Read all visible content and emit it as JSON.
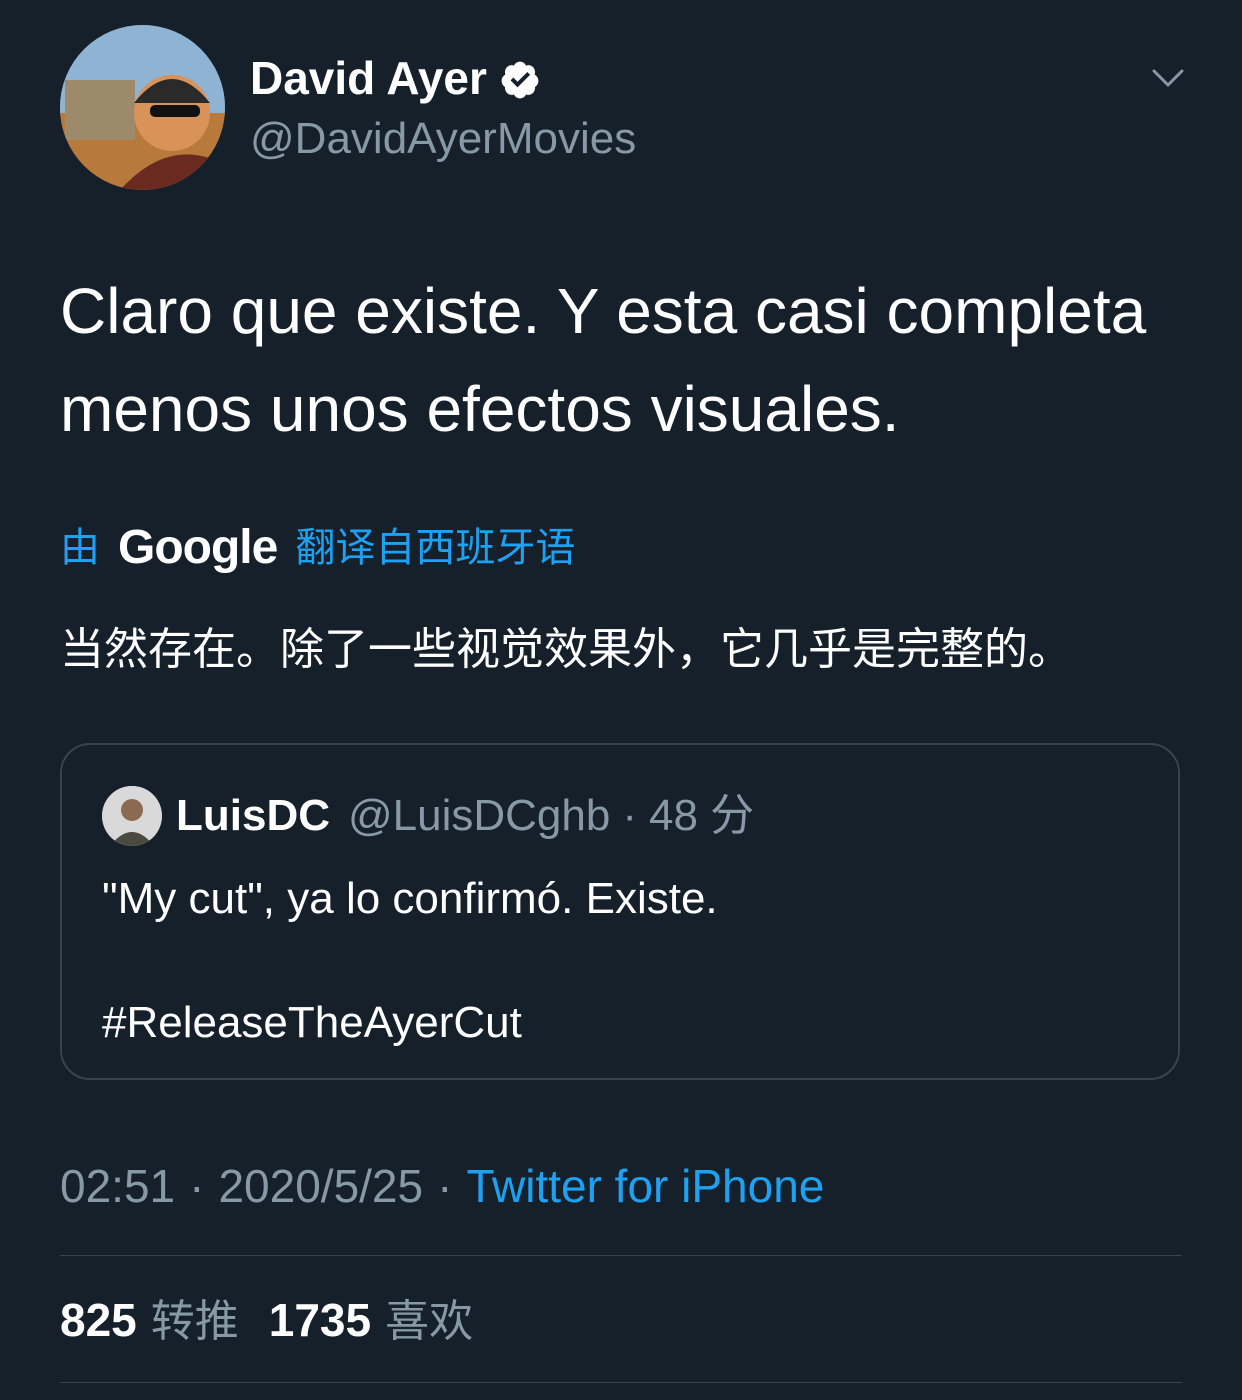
{
  "author": {
    "display_name": "David Ayer",
    "handle": "@DavidAyerMovies",
    "verified_icon": "verified-badge-icon",
    "menu_icon": "chevron-down-icon"
  },
  "tweet": {
    "text": "Claro que existe. Y esta casi completa menos unos efectos visuales."
  },
  "translation": {
    "by_label": "由",
    "provider": "Google",
    "from_label": "翻译自西班牙语",
    "text": "当然存在。除了一些视觉效果外，它几乎是完整的。"
  },
  "quoted_tweet": {
    "name": "LuisDC",
    "handle": "@LuisDCghb",
    "separator": "·",
    "time": "48 分",
    "text": "\"My cut\", ya lo confirmó. Existe.",
    "hashtag": "#ReleaseTheAyerCut"
  },
  "meta": {
    "time": "02:51",
    "separator": "·",
    "date": "2020/5/25",
    "source": "Twitter for iPhone"
  },
  "stats": {
    "retweets_count": "825",
    "retweets_label": "转推",
    "likes_count": "1735",
    "likes_label": "喜欢"
  },
  "colors": {
    "background": "#15202b",
    "accent": "#1da1f2",
    "secondary_text": "#8899a6",
    "border": "#38444d"
  }
}
